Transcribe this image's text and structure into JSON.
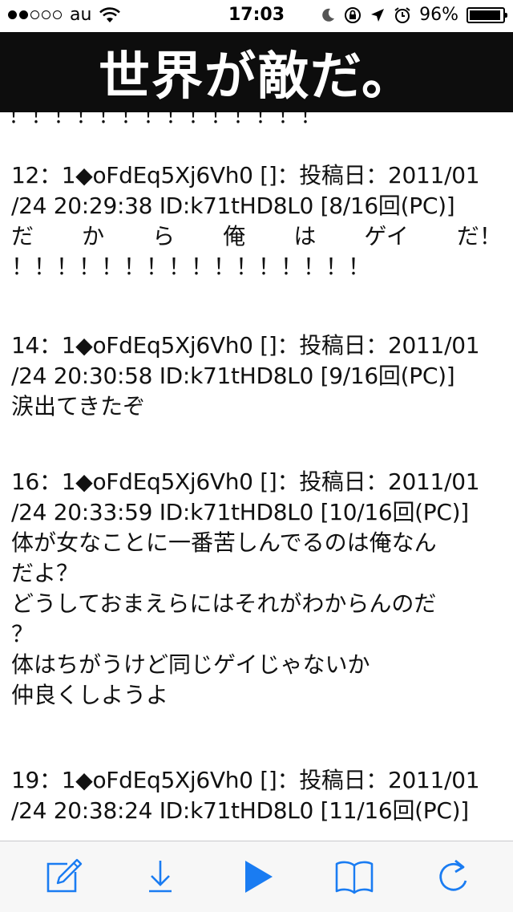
{
  "status_bar": {
    "carrier": "au",
    "time": "17:03",
    "battery": "96%",
    "battery_level": 0.96,
    "signal_bars_filled": 2,
    "signal_bars_total": 5
  },
  "banner": {
    "title": "世界が敵だ。"
  },
  "content": {
    "cut_line": "！！！！！！！！！！！！！！",
    "posts": [
      {
        "header_line1": "12：1◆oFdEq5Xj6Vh0 []：投稿日：2011/01",
        "header_line2": "/24 20:29:38 ID:k71tHD8L0 [8/16回(PC)]",
        "body_spaced": [
          "だ",
          "か",
          "ら",
          "俺",
          "は",
          "ゲイ",
          "だ！"
        ],
        "body": [
          "！！！！！！！！！！！！！！！！"
        ]
      },
      {
        "header_line1": "14：1◆oFdEq5Xj6Vh0 []：投稿日：2011/01",
        "header_line2": "/24 20:30:58 ID:k71tHD8L0 [9/16回(PC)]",
        "body": [
          "涙出てきたぞ"
        ]
      },
      {
        "header_line1": "16：1◆oFdEq5Xj6Vh0 []：投稿日：2011/01",
        "header_line2": "/24 20:33:59 ID:k71tHD8L0 [10/16回(PC)]",
        "body": [
          "体が女なことに一番苦しんでるのは俺なん",
          "だよ？",
          "どうしておまえらにはそれがわからんのだ",
          "？",
          "体はちがうけど同じゲイじゃないか",
          "仲良くしようよ"
        ]
      },
      {
        "header_line1": "19：1◆oFdEq5Xj6Vh0 []：投稿日：2011/01",
        "header_line2": "/24 20:38:24 ID:k71tHD8L0 [11/16回(PC)]",
        "body": []
      }
    ]
  },
  "toolbar": {
    "accent": "#1a7cf2",
    "buttons": [
      "compose-icon",
      "download-icon",
      "play-icon",
      "bookmarks-icon",
      "refresh-icon"
    ]
  }
}
